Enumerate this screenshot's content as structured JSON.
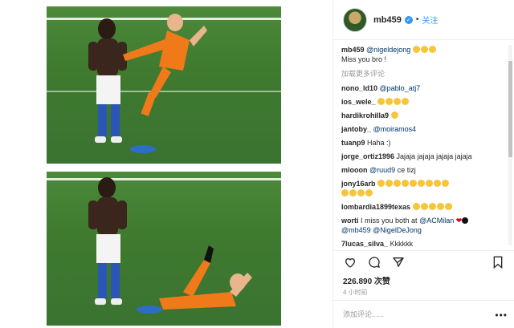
{
  "post": {
    "username": "mb459",
    "follow_label": "关注",
    "separator": "•",
    "likes": "226.890 次赞",
    "time": "4 小时前",
    "add_comment_placeholder": "添加评论......",
    "more_comments": "加载更多评论"
  },
  "caption": {
    "user": "mb459",
    "mention": "@nigeldejong",
    "text": "Miss you bro !"
  },
  "comments": [
    {
      "user": "nono_ld10",
      "mention": "@pablo_atj7",
      "text": "",
      "emojis": 0
    },
    {
      "user": "ios_wele_",
      "mention": "",
      "text": "",
      "emojis": 4
    },
    {
      "user": "hardikrohilla9",
      "mention": "",
      "text": "",
      "emojis": 1
    },
    {
      "user": "jantoby_",
      "mention": "@moiramos4",
      "text": "",
      "emojis": 0
    },
    {
      "user": "tuanp9",
      "mention": "",
      "text": "Haha :)",
      "emojis": 0
    },
    {
      "user": "jorge_ortiz1996",
      "mention": "",
      "text": "Jajaja jajaja jajaja jajaja",
      "emojis": 0
    },
    {
      "user": "mlooon",
      "mention": "@ruud9",
      "text": "ce tizj",
      "emojis": 0
    },
    {
      "user": "jony16arb",
      "mention": "",
      "text": "",
      "emojis": 13
    },
    {
      "user": "lombardia1899texas",
      "mention": "",
      "text": "",
      "emojis": 5
    },
    {
      "user": "",
      "mention": "",
      "text": "",
      "emojis": 0
    },
    {
      "user": "7lucas_silva_",
      "mention": "",
      "text": "Kkkkkk",
      "emojis": 0
    }
  ],
  "long_comment": {
    "user": "worti",
    "text1": "I miss you both at",
    "mention1": "@ACMilan",
    "mention2": "@mb459",
    "mention3": "@NigelDeJong"
  },
  "icons": [
    "verified-icon",
    "heart-icon",
    "comment-icon",
    "share-icon",
    "bookmark-icon",
    "more-dots-icon"
  ]
}
